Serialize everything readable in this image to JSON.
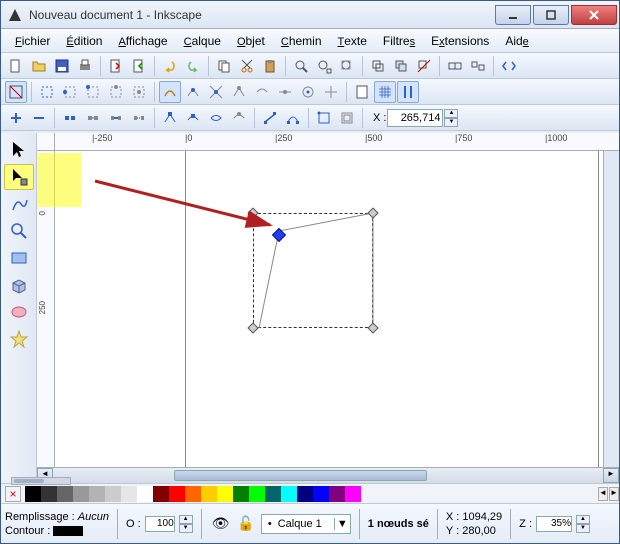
{
  "title": "Nouveau document 1 - Inkscape",
  "menu": [
    "Fichier",
    "Édition",
    "Affichage",
    "Calque",
    "Objet",
    "Chemin",
    "Texte",
    "Filtres",
    "Extensions",
    "Aide"
  ],
  "coord": {
    "x_label": "X :",
    "x_value": "265,714"
  },
  "ruler_h_ticks": [
    "|-250",
    "|0",
    "|250",
    "|500",
    "|750",
    "|1000"
  ],
  "ruler_v_ticks": [
    "0",
    "250"
  ],
  "palette_colors": [
    "#000000",
    "#333333",
    "#666666",
    "#999999",
    "#b3b3b3",
    "#cccccc",
    "#e6e6e6",
    "#ffffff",
    "#800000",
    "#ff0000",
    "#ff6600",
    "#ffcc00",
    "#ffff00",
    "#008000",
    "#00ff00",
    "#006666",
    "#00ffff",
    "#000080",
    "#0000ff",
    "#800080",
    "#ff00ff"
  ],
  "status": {
    "fill_label": "Remplissage :",
    "fill_value": "Aucun",
    "stroke_label": "Contour :",
    "opacity_label": "O :",
    "opacity_value": "100",
    "layer_name": "Calque 1",
    "selection_info": "1 nœuds sé",
    "coord_x_label": "X :",
    "coord_x": "1094,29",
    "coord_y_label": "Y :",
    "coord_y": "280,00",
    "zoom_label": "Z :",
    "zoom_value": "35%"
  },
  "chart_data": null
}
